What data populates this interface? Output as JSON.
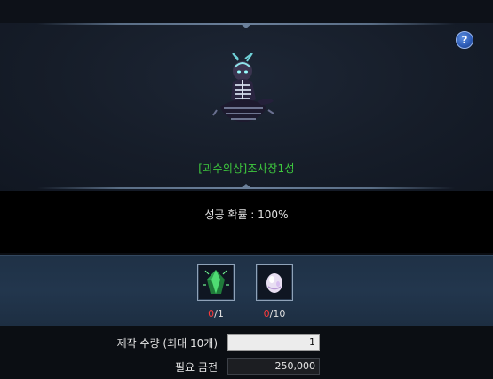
{
  "header": {
    "help_label": "?"
  },
  "item": {
    "name": "[괴수의상]조사장1성",
    "art_icon": "monster-costume-icon"
  },
  "craft": {
    "success_label": "성공 확률 : 100%"
  },
  "materials": [
    {
      "icon": "green-crystal-icon",
      "have": "0",
      "need": "/1"
    },
    {
      "icon": "pearl-egg-icon",
      "have": "0",
      "need": "/10"
    }
  ],
  "form": {
    "quantity_label": "제작 수량 (최대 10개)",
    "quantity_value": "1",
    "gold_label": "필요 금전",
    "gold_value": "250,000"
  },
  "colors": {
    "item_name": "#3ec93e",
    "have_count": "#ff3b3b",
    "panel": "#22364d"
  }
}
